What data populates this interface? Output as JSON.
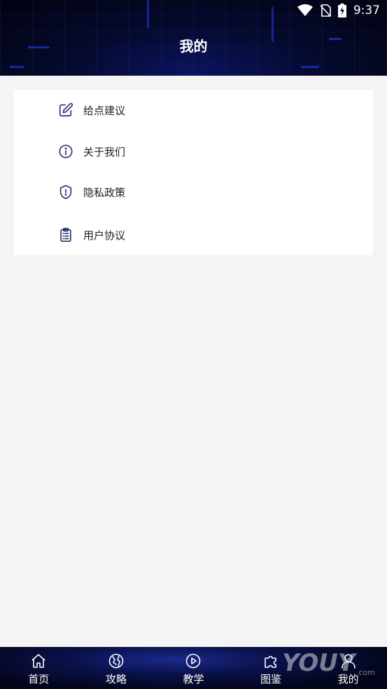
{
  "status_bar": {
    "time": "9:37"
  },
  "header": {
    "title": "我的"
  },
  "menu": {
    "items": [
      {
        "label": "给点建议",
        "icon": "edit-icon"
      },
      {
        "label": "关于我们",
        "icon": "info-icon"
      },
      {
        "label": "隐私政策",
        "icon": "shield-icon"
      },
      {
        "label": "用户协议",
        "icon": "clipboard-icon"
      }
    ]
  },
  "tabbar": {
    "tabs": [
      {
        "label": "首页",
        "icon": "home-icon"
      },
      {
        "label": "攻略",
        "icon": "compass-icon"
      },
      {
        "label": "教学",
        "icon": "play-circle-icon"
      },
      {
        "label": "图鉴",
        "icon": "puzzle-icon"
      },
      {
        "label": "我的",
        "icon": "user-icon",
        "active": true
      }
    ]
  },
  "watermark": {
    "text": "YOUY.com"
  },
  "colors": {
    "icon": "#2b3170",
    "page_bg": "#f4f4f4",
    "card_bg": "#ffffff"
  }
}
